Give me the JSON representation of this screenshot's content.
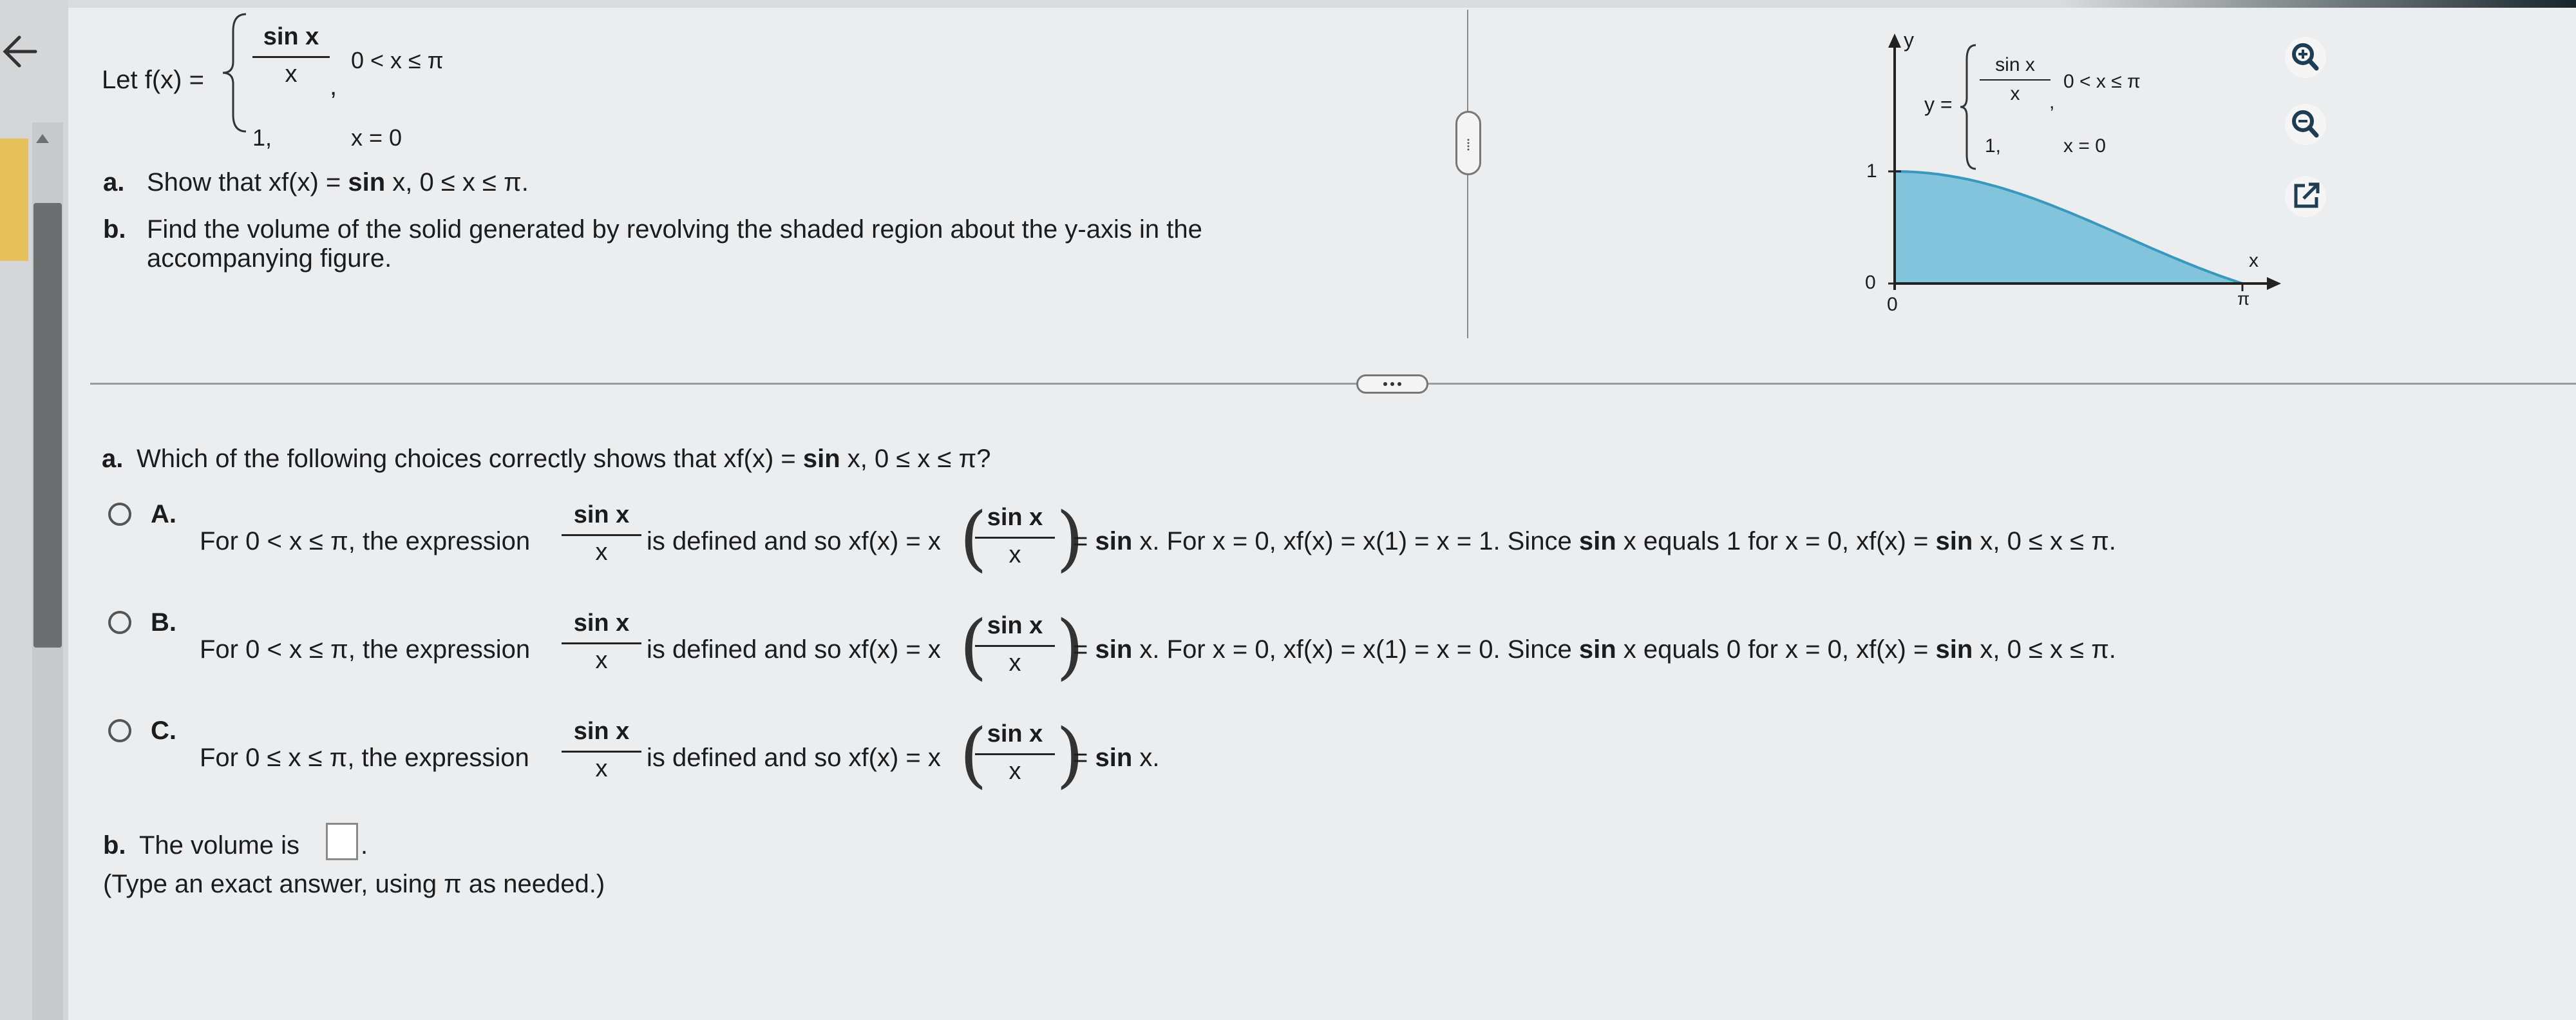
{
  "problem": {
    "let_prefix": "Let f(x) =",
    "case1_num": "sin x",
    "case1_den": "x",
    "case1_comma": ",",
    "case1_cond": "0 < x ≤ π",
    "case2_val": "1,",
    "case2_cond": "x = 0",
    "part_a_label": "a.",
    "part_a_text1": "Show that xf(x) =",
    "part_a_sin": "sin",
    "part_a_text2": "x, 0 ≤ x ≤ π.",
    "part_b_label": "b.",
    "part_b_line1": "Find the volume of the solid generated by revolving the shaded region about the y-axis in the",
    "part_b_line2": "accompanying figure."
  },
  "figure": {
    "y_axis": "y",
    "x_axis": "x",
    "y_eq": "y =",
    "case1_num": "sin x",
    "case1_den": "x",
    "case1_cond": "0 < x ≤ π",
    "case2_val": "1,",
    "case2_cond": "x = 0",
    "tick_one": "1",
    "tick_zero_y": "0",
    "tick_zero_x": "0",
    "tick_pi": "π",
    "fill_color": "#5fb6d6",
    "curve_color": "#3a97be"
  },
  "question_a": {
    "label": "a.",
    "text1": "Which of the following choices correctly shows that xf(x) =",
    "sin": "sin",
    "text2": "x, 0 ≤ x ≤ π?"
  },
  "options": [
    {
      "letter": "A.",
      "pre": "For 0 < x ≤ π, the expression",
      "frac_num": "sin x",
      "frac_den": "x",
      "mid": "is defined and so xf(x) = x",
      "p_num": "sin x",
      "p_den": "x",
      "eq": "=",
      "sin1": "sin",
      "after1": "x. For x = 0, xf(x) = x(1) = x = 1. Since",
      "sin2": "sin",
      "after2": "x equals 1 for x = 0, xf(x) =",
      "sin3": "sin",
      "after3": "x, 0 ≤ x ≤ π."
    },
    {
      "letter": "B.",
      "pre": "For 0 < x ≤ π, the expression",
      "frac_num": "sin x",
      "frac_den": "x",
      "mid": "is defined and so xf(x) = x",
      "p_num": "sin x",
      "p_den": "x",
      "eq": "=",
      "sin1": "sin",
      "after1": "x. For x = 0, xf(x) = x(1) = x = 0. Since",
      "sin2": "sin",
      "after2": "x equals 0 for x = 0, xf(x) =",
      "sin3": "sin",
      "after3": "x, 0 ≤ x ≤ π."
    },
    {
      "letter": "C.",
      "pre": "For 0 ≤ x ≤ π, the expression",
      "frac_num": "sin x",
      "frac_den": "x",
      "mid": "is defined and so xf(x) = x",
      "p_num": "sin x",
      "p_den": "x",
      "eq": "=",
      "sin1": "sin",
      "after1": "x."
    }
  ],
  "question_b": {
    "label": "b.",
    "text": "The volume is",
    "period": ".",
    "hint": "(Type an exact answer, using π as needed.)"
  },
  "tools": {
    "zoom_in": "zoom-in-icon",
    "zoom_out": "zoom-out-icon",
    "popout": "external-link-icon"
  }
}
